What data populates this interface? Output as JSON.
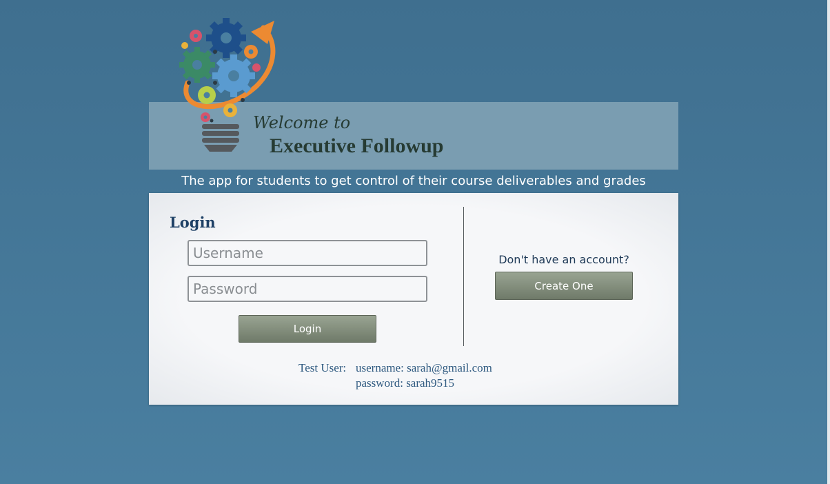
{
  "header": {
    "welcome": "Welcome to",
    "app_name": "Executive Followup",
    "tagline": "The app for students to get control of their course deliverables and grades",
    "logo_icon": "lightbulb-gears-icon"
  },
  "login": {
    "title": "Login",
    "username_placeholder": "Username",
    "password_placeholder": "Password",
    "button_label": "Login"
  },
  "signup": {
    "prompt": "Don't have an account?",
    "button_label": "Create One"
  },
  "test_account": {
    "label": "Test User:",
    "username_line": "username: sarah@gmail.com",
    "password_line": "password: sarah9515"
  },
  "colors": {
    "background": "#4a7fa0",
    "banner": "#7a9db1",
    "title_text": "#263b33",
    "button": "#7d8877",
    "heading_blue": "#1f4166"
  }
}
